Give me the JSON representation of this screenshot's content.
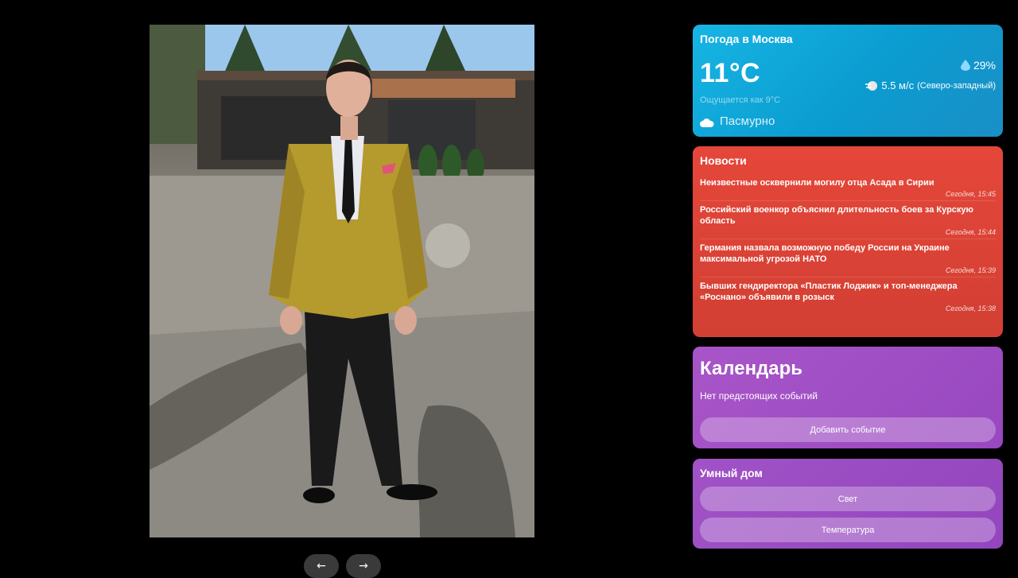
{
  "gallery": {
    "prev_label": "←",
    "next_label": "→"
  },
  "weather": {
    "title": "Погода в Москва",
    "temperature": "11°C",
    "feels_like": "Ощущается как 9°C",
    "condition": "Пасмурно",
    "humidity": "29%",
    "wind_speed": "5.5 м/с",
    "wind_direction": "(Северо-западный)",
    "icons": {
      "humidity": "water-drop-icon",
      "wind": "wind-icon",
      "condition": "cloud-icon"
    }
  },
  "news": {
    "title": "Новости",
    "items": [
      {
        "headline": "Неизвестные осквернили могилу отца Асада в Сирии",
        "time": "Сегодня, 15:45"
      },
      {
        "headline": "Российский военкор объяснил длительность боев за Курскую область",
        "time": "Сегодня, 15:44"
      },
      {
        "headline": "Германия назвала возможную победу России на Украине максимальной угрозой НАТО",
        "time": "Сегодня, 15:39"
      },
      {
        "headline": "Бывших гендиректора «Пластик Лоджик» и топ-менеджера «Роснано» объявили в розыск",
        "time": "Сегодня, 15:38"
      }
    ]
  },
  "calendar": {
    "title": "Календарь",
    "empty_text": "Нет предстоящих событий",
    "add_label": "Добавить событие"
  },
  "smart_home": {
    "title": "Умный дом",
    "light_label": "Свет",
    "temperature_label": "Температура"
  },
  "colors": {
    "weather": "#0b9cd0",
    "news": "#d23f33",
    "calendar": "#9848c0",
    "smart_home": "#9346bd"
  }
}
